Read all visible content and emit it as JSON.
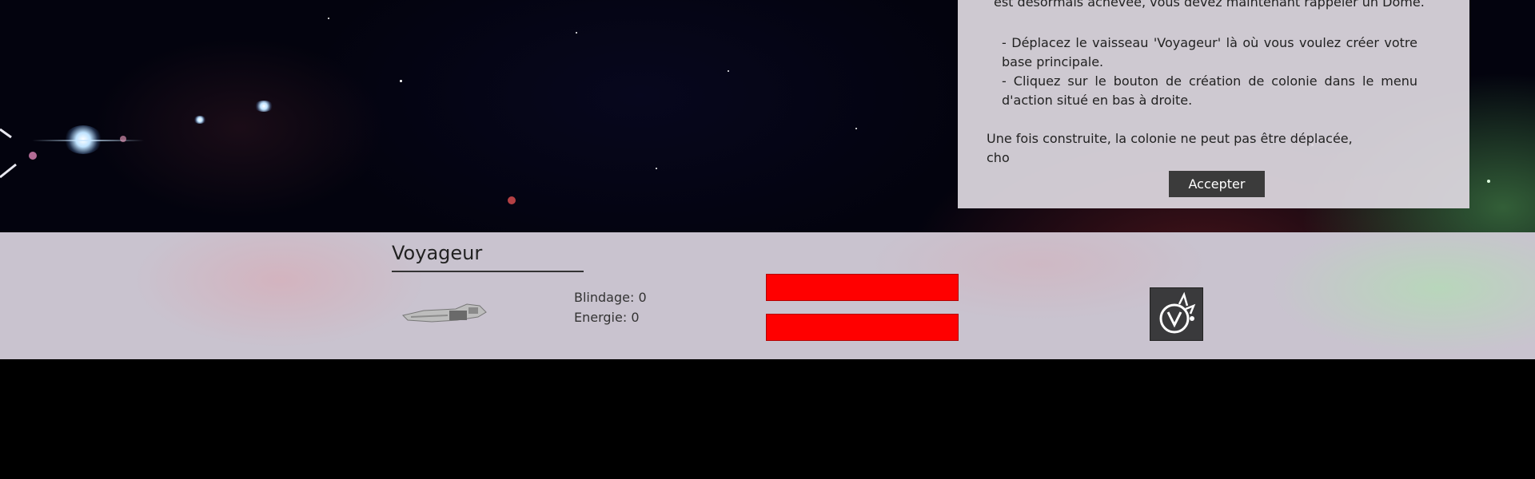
{
  "dialog": {
    "intro": "est désormais achevée, vous devez maintenant rappeler un Dome.",
    "bullet_1": "- Déplacez le vaisseau 'Voyageur' là où vous voulez créer votre base principale.",
    "bullet_2": "- Cliquez sur le bouton de création de colonie dans le menu d'action situé en bas à droite.",
    "outro_line1": "Une fois construite, la colonie ne peut pas être déplacée,",
    "outro_line2": "cho",
    "accept_label": "Accepter"
  },
  "ship_panel": {
    "name": "Voyageur",
    "armor_label": "Blindage:",
    "armor_value": "0",
    "energy_label": "Energie:",
    "energy_value": "0",
    "armor_bar_fill": 1.0,
    "energy_bar_fill": 1.0,
    "bar_color": "#ff0000"
  },
  "actions": {
    "colony_button_icon": "colony-create-icon"
  },
  "colors": {
    "hud_background": "#c9c3cf",
    "dialog_background": "#ded8e0",
    "button_dark": "#3b3b3b"
  }
}
